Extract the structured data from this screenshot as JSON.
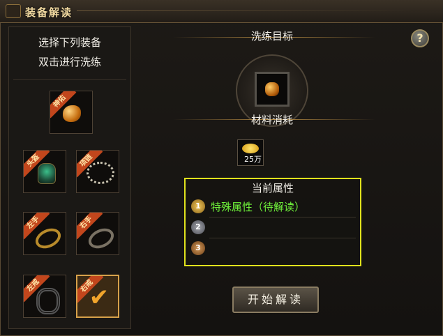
{
  "window": {
    "title": "装备解读"
  },
  "left_panel": {
    "hint_line1": "选择下列装备",
    "hint_line2": "双击进行洗练",
    "slots": [
      {
        "tag": "神佑",
        "item": "gem-icon",
        "selected": false
      },
      {
        "tag": "头盔",
        "item": "helmet-icon",
        "selected": false
      },
      {
        "tag": "项链",
        "item": "necklace-icon",
        "selected": false
      },
      {
        "tag": "左手",
        "item": "ring-icon",
        "selected": false
      },
      {
        "tag": "右手",
        "item": "ring-icon",
        "selected": false
      },
      {
        "tag": "左戒",
        "item": "bracelet-icon",
        "selected": false
      },
      {
        "tag": "右戒",
        "item": "checkmark-icon",
        "selected": true
      }
    ]
  },
  "right_panel": {
    "target_title": "洗练目标",
    "material_title": "材料消耗",
    "material_qty": "25万",
    "props_title": "当前属性",
    "props": [
      {
        "index": "1",
        "text": "特殊属性（待解读）"
      },
      {
        "index": "2",
        "text": ""
      },
      {
        "index": "3",
        "text": ""
      }
    ],
    "start_button": "开始解读",
    "help_symbol": "?"
  },
  "colors": {
    "accent_gold": "#d7a14a",
    "highlight_yellow": "#e0e21c",
    "attr_green": "#6ff23a",
    "tag_orange": "#c2461c"
  }
}
